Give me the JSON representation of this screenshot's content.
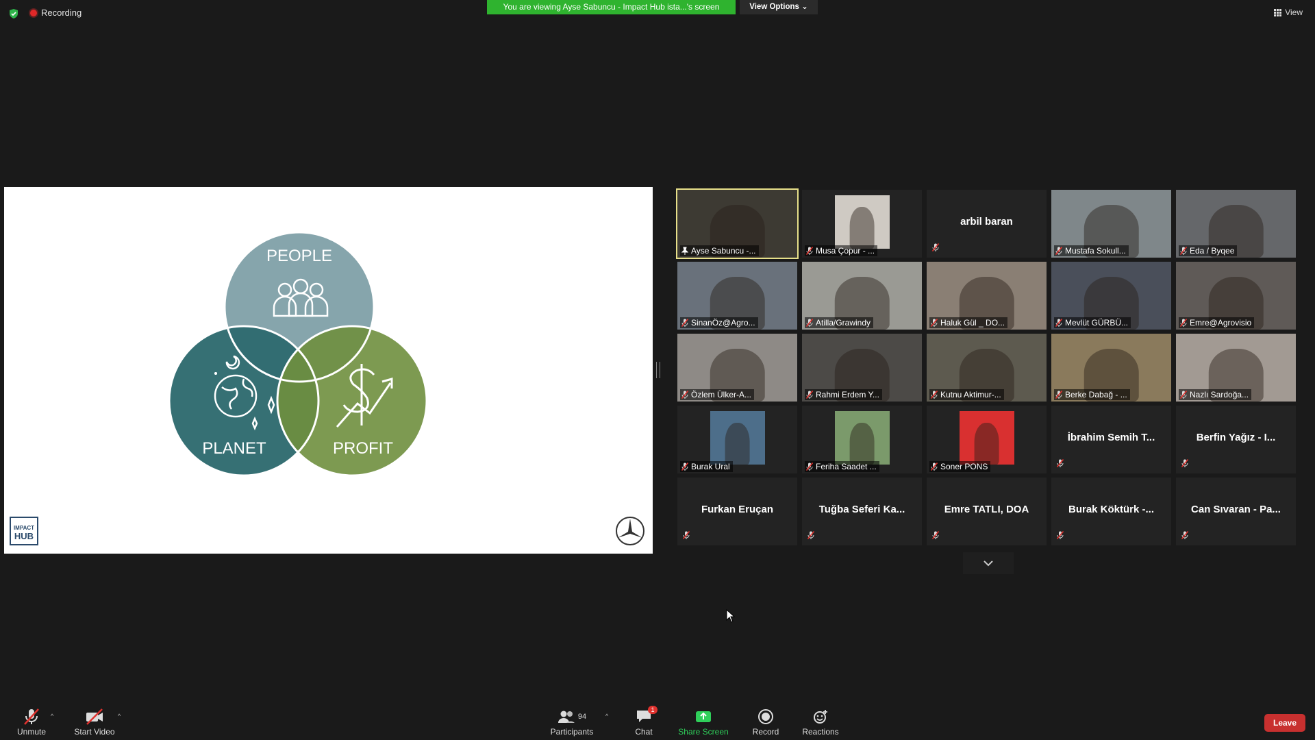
{
  "topbar": {
    "recording_label": "Recording",
    "viewing_banner": "You are viewing Ayse Sabuncu - Impact Hub ista...'s screen",
    "view_options_label": "View Options ⌄",
    "view_label": "View"
  },
  "slide": {
    "circle_people": "PEOPLE",
    "circle_planet": "PLANET",
    "circle_profit": "PROFIT",
    "logo_line1": "IMPACT",
    "logo_line2": "HUB",
    "colors": {
      "people": "#7fa0a8",
      "planet": "#2f6b6f",
      "profit": "#6f8f3e"
    }
  },
  "participants": [
    {
      "name": "Ayse Sabuncu -...",
      "video": true,
      "active": true,
      "pinned": true,
      "bg": "#3d3a33"
    },
    {
      "name": "Musa Çopur - ...",
      "video": true,
      "small": true,
      "bg": "#cfcac3"
    },
    {
      "name": "arbil baran",
      "video": false
    },
    {
      "name": "Mustafa Sokull...",
      "video": true,
      "bg": "#7f878a"
    },
    {
      "name": "Eda / Byqee",
      "video": true,
      "bg": "#65676a"
    },
    {
      "name": "SinanÖz@Agro...",
      "video": true,
      "bg": "#69717b"
    },
    {
      "name": "Atilla/Grawindy",
      "video": true,
      "bg": "#9a9a94"
    },
    {
      "name": "Haluk Gül _ DO...",
      "video": true,
      "bg": "#8a7f74"
    },
    {
      "name": "Mevlüt GÜRBÜ...",
      "video": true,
      "bg": "#4a4f5a"
    },
    {
      "name": "Emre@Agrovisio",
      "video": true,
      "bg": "#5f5a57"
    },
    {
      "name": "Özlem Ülker-A...",
      "video": true,
      "bg": "#8e8a86"
    },
    {
      "name": "Rahmi Erdem Y...",
      "video": true,
      "bg": "#4c4a47"
    },
    {
      "name": "Kutnu Aktimur-...",
      "video": true,
      "bg": "#5d5a4f"
    },
    {
      "name": "Berke Dabağ - ...",
      "video": true,
      "bg": "#8a7a5c"
    },
    {
      "name": "Nazlı Sardoğa...",
      "video": true,
      "bg": "#a29a93"
    },
    {
      "name": "Burak Ural",
      "video": true,
      "small": true,
      "bg": "#4d6e8a"
    },
    {
      "name": "Feriha Saadet ...",
      "video": true,
      "small": true,
      "bg": "#7b9a6b"
    },
    {
      "name": "Soner PONS",
      "video": true,
      "small": true,
      "bg": "#d93030"
    },
    {
      "name": "İbrahim Semih T...",
      "video": false
    },
    {
      "name": "Berfin Yağız - I...",
      "video": false
    },
    {
      "name": "Furkan Eruçan",
      "video": false
    },
    {
      "name": "Tuğba Seferi Ka...",
      "video": false
    },
    {
      "name": "Emre TATLI, DOA",
      "video": false
    },
    {
      "name": "Burak Köktürk -...",
      "video": false
    },
    {
      "name": "Can Sıvaran - Pa...",
      "video": false
    }
  ],
  "toolbar": {
    "unmute": "Unmute",
    "start_video": "Start Video",
    "participants": "Participants",
    "participants_count": "94",
    "chat": "Chat",
    "chat_badge": "1",
    "share_screen": "Share Screen",
    "record": "Record",
    "reactions": "Reactions",
    "leave": "Leave"
  }
}
